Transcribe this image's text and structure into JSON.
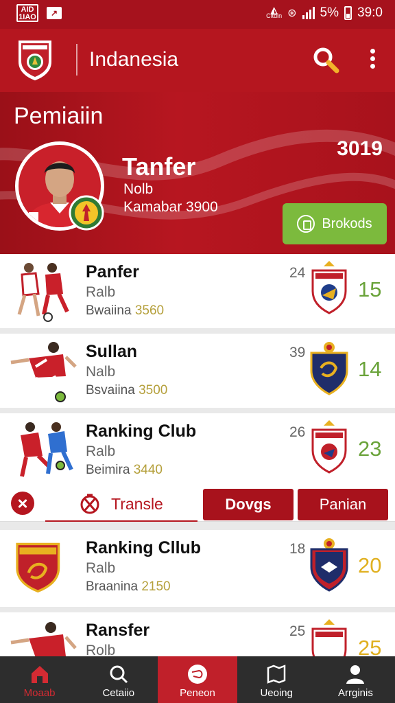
{
  "status": {
    "left_box": "AID\n1IAO",
    "notif": "↗",
    "carrier": "Citdin",
    "battery": "5%",
    "time": "39:0"
  },
  "appbar": {
    "logo_text": "INDANESIA",
    "title": "Indanesia"
  },
  "hero": {
    "heading": "Pemiaiin",
    "year": "3019",
    "name": "Tanfer",
    "position": "Nolb",
    "meta": "Kamabar 3900",
    "button_label": "Brokods"
  },
  "list": [
    {
      "name": "Panfer",
      "position": "Ralb",
      "sub_prefix": "Bwaiina",
      "sub_value": "3560",
      "num": "24",
      "score": "15",
      "crest_text": "PERSIRA"
    },
    {
      "name": "Sullan",
      "position": "Nalb",
      "sub_prefix": "Bsvaiina",
      "sub_value": "3500",
      "num": "39",
      "score": "14",
      "crest_text": ""
    },
    {
      "name": "Ranking Club",
      "position": "Ralb",
      "sub_prefix": "Beimira",
      "sub_value": "3440",
      "num": "26",
      "score": "23",
      "crest_text": "PERSIRE"
    },
    {
      "name": "Ranking Cllub",
      "position": "Ralb",
      "sub_prefix": "Braanina",
      "sub_value": "2150",
      "num": "18",
      "score": "20",
      "crest_text": "ECNEDIAKI"
    },
    {
      "name": "Ransfer",
      "position": "Rolb",
      "sub_prefix": "",
      "sub_value": "",
      "num": "25",
      "score": "25",
      "crest_text": "PERSIRO"
    }
  ],
  "actions": {
    "transfer_label": "Transle",
    "tab1": "Dovgs",
    "tab2": "Panian"
  },
  "nav": [
    {
      "label": "Moaab"
    },
    {
      "label": "Cetaiio"
    },
    {
      "label": "Peneon"
    },
    {
      "label": "Ueoing"
    },
    {
      "label": "Arrginis"
    }
  ],
  "colors": {
    "primary": "#b5161f",
    "button_green": "#7cba3d",
    "score_green": "#6aa33a",
    "score_gold": "#e0b020",
    "nav_bg": "#2d2d2d"
  }
}
